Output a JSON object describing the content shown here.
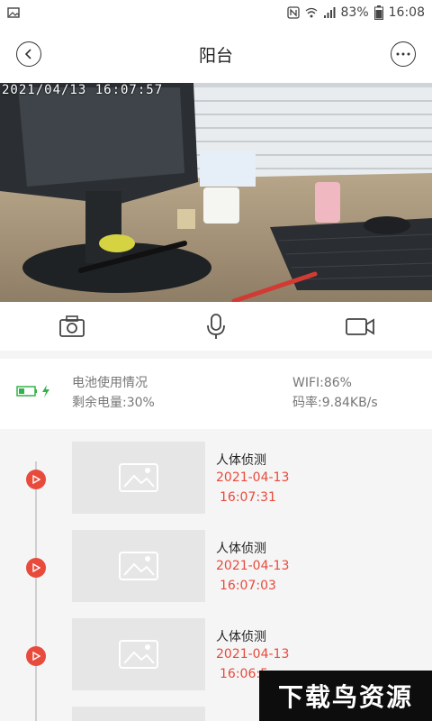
{
  "status_bar": {
    "battery_percent": "83%",
    "time": "16:08",
    "icons": [
      "image-icon",
      "nfc-icon",
      "wifi-icon",
      "signal-icon",
      "battery-icon"
    ]
  },
  "header": {
    "title": "阳台",
    "back_icon": "chevron-left-icon",
    "more_icon": "more-horizontal-icon"
  },
  "video": {
    "timestamp": "2021/04/13 16:07:57"
  },
  "controls": [
    {
      "icon": "camera-icon"
    },
    {
      "icon": "microphone-icon"
    },
    {
      "icon": "video-camera-icon"
    }
  ],
  "info": {
    "battery_label": "电池使用情况",
    "battery_remaining": "剩余电量:30%",
    "wifi": "WIFI:86%",
    "bitrate": "码率:9.84KB/s",
    "colors": {
      "battery": "#33b249",
      "accent": "#e84a3c"
    }
  },
  "events": [
    {
      "title": "人体侦测",
      "date": "2021-04-13",
      "time": "16:07:31"
    },
    {
      "title": "人体侦测",
      "date": "2021-04-13",
      "time": "16:07:03"
    },
    {
      "title": "人体侦测",
      "date": "2021-04-13",
      "time": "16:06:5"
    }
  ],
  "watermark": {
    "text": "下载鸟资源"
  }
}
